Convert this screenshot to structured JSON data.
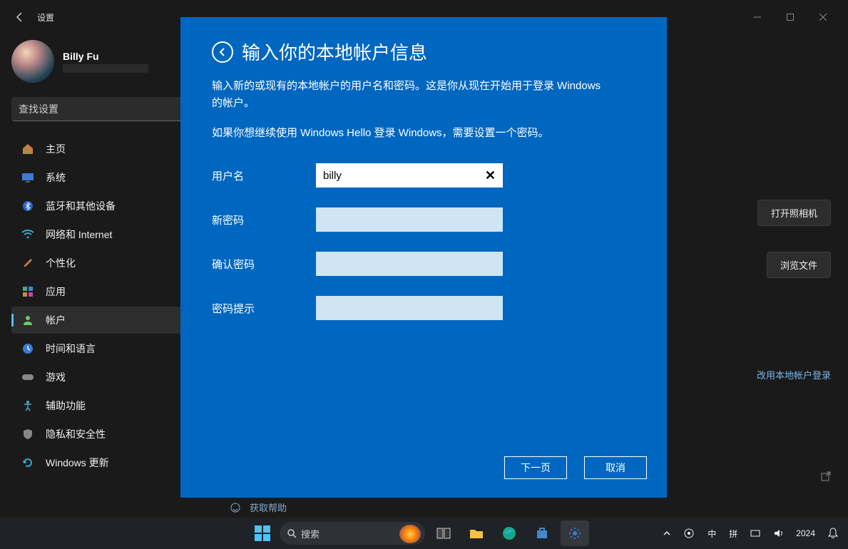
{
  "window": {
    "title": "设置"
  },
  "profile": {
    "name": "Billy Fu"
  },
  "search_placeholder": "查找设置",
  "nav": [
    {
      "label": "主页"
    },
    {
      "label": "系统"
    },
    {
      "label": "蓝牙和其他设备"
    },
    {
      "label": "网络和 Internet"
    },
    {
      "label": "个性化"
    },
    {
      "label": "应用"
    },
    {
      "label": "帐户"
    },
    {
      "label": "时间和语言"
    },
    {
      "label": "游戏"
    },
    {
      "label": "辅助功能"
    },
    {
      "label": "隐私和安全性"
    },
    {
      "label": "Windows 更新"
    }
  ],
  "right": {
    "camera": "打开照相机",
    "browse": "浏览文件",
    "local_account": "改用本地帐户登录"
  },
  "help_link": "获取帮助",
  "modal": {
    "title": "输入你的本地帐户信息",
    "desc1": "输入新的或现有的本地帐户的用户名和密码。这是你从现在开始用于登录 Windows 的帐户。",
    "desc2": "如果你想继续使用 Windows Hello 登录 Windows，需要设置一个密码。",
    "labels": {
      "username": "用户名",
      "new_password": "新密码",
      "confirm_password": "确认密码",
      "hint": "密码提示"
    },
    "values": {
      "username": "billy"
    },
    "buttons": {
      "next": "下一页",
      "cancel": "取消"
    }
  },
  "taskbar": {
    "search": "搜索",
    "ime_ch": "中",
    "ime_pin": "拼",
    "year": "2024"
  }
}
